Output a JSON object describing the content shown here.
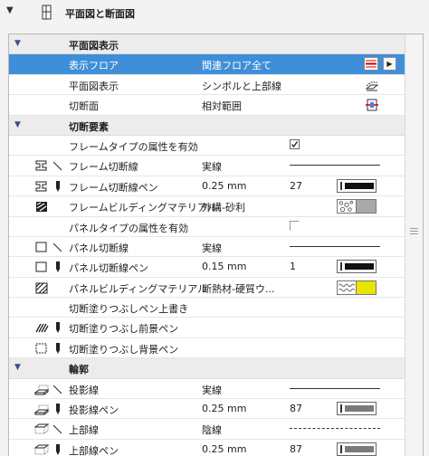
{
  "header": {
    "title": "平面図と断面図"
  },
  "groups": {
    "floor_plan_display": "平面図表示",
    "cut_elements": "切断要素",
    "outline": "輪郭"
  },
  "rows": {
    "show_on_stories": {
      "name": "表示フロア",
      "value": "関連フロア全て"
    },
    "floor_plan_display": {
      "name": "平面図表示",
      "value": "シンボルと上部線"
    },
    "cut_plane": {
      "name": "切断面",
      "value": "相対範囲"
    },
    "frame_type_attr": {
      "name": "フレームタイプの属性を有効",
      "checked": true
    },
    "frame_cut_line": {
      "name": "フレーム切断線",
      "value": "実線"
    },
    "frame_cut_line_pen": {
      "name": "フレーム切断線ペン",
      "value": "0.25 mm",
      "pen": "27"
    },
    "frame_building_material": {
      "name": "フレームビルディングマテリアル",
      "value": "外構-砂利"
    },
    "panel_type_attr": {
      "name": "パネルタイプの属性を有効",
      "checked": false
    },
    "panel_cut_line": {
      "name": "パネル切断線",
      "value": "実線"
    },
    "panel_cut_line_pen": {
      "name": "パネル切断線ペン",
      "value": "0.15 mm",
      "pen": "1"
    },
    "panel_building_material": {
      "name": "パネルビルディングマテリアル",
      "value": "断熱材-硬質ウ..."
    },
    "cut_fill_pen_override": {
      "name": "切断塗りつぶしペン上書き"
    },
    "cut_fill_foreground_pen": {
      "name": "切断塗りつぶし前景ペン"
    },
    "cut_fill_background_pen": {
      "name": "切断塗りつぶし背景ペン"
    },
    "projected_line": {
      "name": "投影線",
      "value": "実線"
    },
    "projected_line_pen": {
      "name": "投影線ペン",
      "value": "0.25 mm",
      "pen": "87"
    },
    "overhead_line": {
      "name": "上部線",
      "value": "陰線"
    },
    "overhead_line_pen": {
      "name": "上部線ペン",
      "value": "0.25 mm",
      "pen": "87"
    }
  },
  "colors": {
    "selection": "#3f8fd8",
    "panel_material_fill": "#e6e600",
    "frame_material_fill": "#a9a9a9"
  }
}
